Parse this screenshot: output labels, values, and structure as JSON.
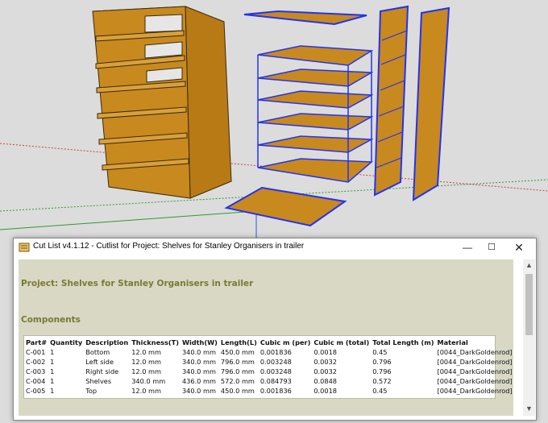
{
  "window": {
    "title": "Cut List v4.1.12 -  Cutlist for Project: Shelves for Stanley Organisers in trailer",
    "minimize_icon": "minimize-icon",
    "maximize_icon": "maximize-icon",
    "close_icon": "close-icon"
  },
  "report": {
    "project_heading": "Project: Shelves for Stanley Organisers in trailer",
    "components_heading": "Components",
    "heading_color": "#7a7a33",
    "background_color": "#d8d8c5",
    "columns": [
      "Part#",
      "Quantity",
      "Description",
      "Thickness(T)",
      "Width(W)",
      "Length(L)",
      "Cubic m (per)",
      "Cubic m (total)",
      "Total Length (m)",
      "Material"
    ],
    "rows": [
      [
        "C-001",
        "1",
        "Bottom",
        "12.0 mm",
        "340.0 mm",
        "450.0 mm",
        "0.001836",
        "0.0018",
        "0.45",
        "[0044_DarkGoldenrod]"
      ],
      [
        "C-002",
        "1",
        "Left side",
        "12.0 mm",
        "340.0 mm",
        "796.0 mm",
        "0.003248",
        "0.0032",
        "0.796",
        "[0044_DarkGoldenrod]"
      ],
      [
        "C-003",
        "1",
        "Right side",
        "12.0 mm",
        "340.0 mm",
        "796.0 mm",
        "0.003248",
        "0.0032",
        "0.796",
        "[0044_DarkGoldenrod]"
      ],
      [
        "C-004",
        "1",
        "Shelves",
        "340.0 mm",
        "436.0 mm",
        "572.0 mm",
        "0.084793",
        "0.0848",
        "0.572",
        "[0044_DarkGoldenrod]"
      ],
      [
        "C-005",
        "1",
        "Top",
        "12.0 mm",
        "340.0 mm",
        "450.0 mm",
        "0.001836",
        "0.0018",
        "0.45",
        "[0044_DarkGoldenrod]"
      ]
    ]
  },
  "model": {
    "wood_color": "#c8891e",
    "selection_color": "#2233ee",
    "edge_color": "#3a2a10"
  }
}
